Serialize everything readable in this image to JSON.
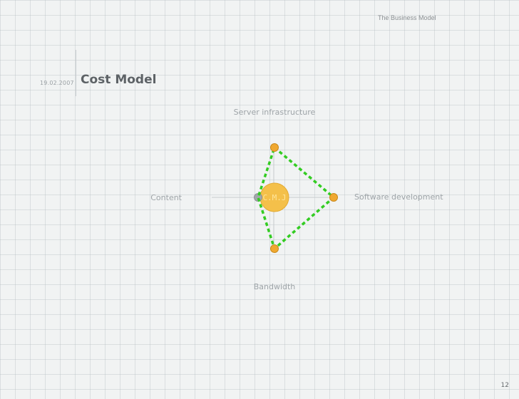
{
  "header": {
    "section_title": "The Business Model"
  },
  "slide": {
    "date": "19.02.2007",
    "title": "Cost Model",
    "page_number": "12"
  },
  "diagram": {
    "center_label": "C.M.J",
    "axes": {
      "top": "Server infrastructure",
      "right": "Software development",
      "bottom": "Bandwidth",
      "left": "Content"
    },
    "colors": {
      "center_fill": "#f4c04a",
      "node_fill": "#f0a830",
      "polygon_stroke": "#33cc22",
      "axis_line": "#c7cbce",
      "label_text": "#9ea4a8"
    }
  }
}
